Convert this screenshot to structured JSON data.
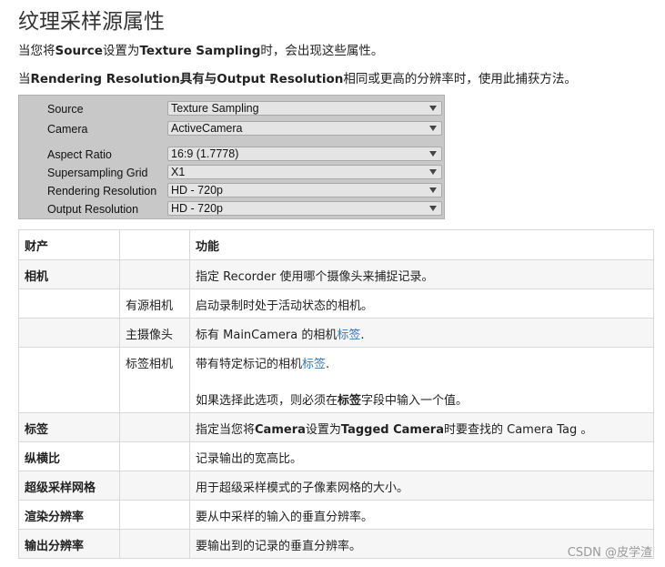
{
  "heading": "纹理采样源属性",
  "intro1": {
    "prefix": "当您将",
    "b1": "Source",
    "mid1": "设置为",
    "b2": "Texture Sampling",
    "suffix": "时，会出现这些属性。"
  },
  "intro2": {
    "prefix": "当",
    "b1": "Rendering Resolution具有与Output Resolution",
    "suffix": "相同或更高的分辨率时，使用此捕获方法。"
  },
  "inspector": [
    {
      "label": "Source",
      "value": "Texture Sampling"
    },
    {
      "label": "Camera",
      "value": "ActiveCamera"
    },
    {
      "label": "Aspect Ratio",
      "value": "16:9 (1.7778)"
    },
    {
      "label": "Supersampling Grid",
      "value": "X1"
    },
    {
      "label": "Rendering Resolution",
      "value": "HD - 720p"
    },
    {
      "label": "Output Resolution",
      "value": "HD - 720p"
    }
  ],
  "table": {
    "headers": [
      "财产",
      "",
      "功能"
    ],
    "rows": [
      {
        "c1": "相机",
        "c2": "",
        "c3": "指定 Recorder 使用哪个摄像头来捕捉记录。"
      },
      {
        "c1": "",
        "c2": "有源相机",
        "c3": "启动录制时处于活动状态的相机。"
      },
      {
        "c1": "",
        "c2": "主摄像头",
        "c3a": "标有 MainCamera 的相机",
        "c3link": "标签",
        "c3b": "."
      },
      {
        "c1": "",
        "c2": "标签相机",
        "c3a": "带有特定标记的相机",
        "c3link": "标签",
        "c3b": ".",
        "c3p2a": "如果选择此选项，则必须在",
        "c3p2b": "标签",
        "c3p2c": "字段中输入一个值。"
      },
      {
        "c1": "标签",
        "c2": "",
        "c3a": "指定当您将",
        "c3b1": "Camera",
        "c3m": "设置为",
        "c3b2": "Tagged Camera",
        "c3c": "时要查找的 Camera Tag 。"
      },
      {
        "c1": "纵横比",
        "c2": "",
        "c3": "记录输出的宽高比。"
      },
      {
        "c1": "超级采样网格",
        "c2": "",
        "c3": "用于超级采样模式的子像素网格的大小。"
      },
      {
        "c1": "渲染分辨率",
        "c2": "",
        "c3": "要从中采样的输入的垂直分辨率。"
      },
      {
        "c1": "输出分辨率",
        "c2": "",
        "c3": "要输出到的记录的垂直分辨率。"
      }
    ]
  },
  "watermark": "CSDN @皮学渣"
}
